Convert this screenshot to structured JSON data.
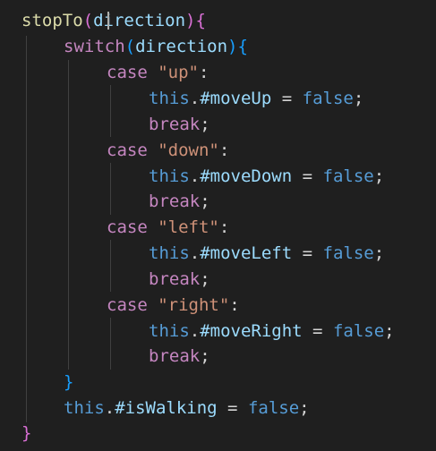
{
  "code": {
    "function_name": "stopTo",
    "param": "direction",
    "switch_kw": "switch",
    "case_kw": "case",
    "break_kw": "break",
    "this_kw": "this",
    "false_kw": "false",
    "cases": [
      {
        "label": "\"up\"",
        "prop": "#moveUp"
      },
      {
        "label": "\"down\"",
        "prop": "#moveDown"
      },
      {
        "label": "\"left\"",
        "prop": "#moveLeft"
      },
      {
        "label": "\"right\"",
        "prop": "#moveRight"
      }
    ],
    "final_prop": "#isWalking"
  },
  "colors": {
    "background": "#1f1f1f",
    "function": "#dcdcaa",
    "keyword_control": "#c586c0",
    "keyword": "#569cd6",
    "string": "#ce9178",
    "variable": "#9cdcfe",
    "bracket_level1": "#da70d6",
    "bracket_level2": "#179fff"
  }
}
